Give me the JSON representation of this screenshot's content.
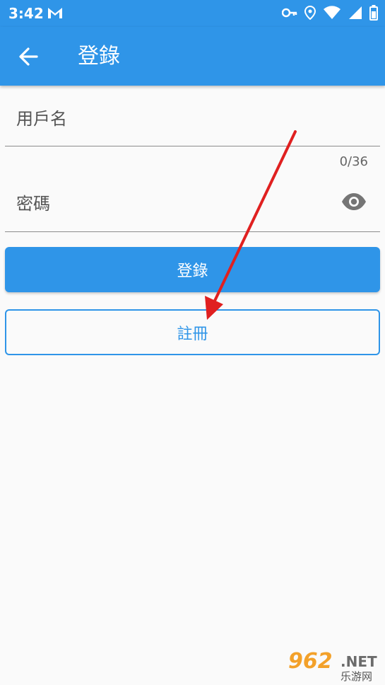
{
  "status_bar": {
    "time": "3:42"
  },
  "app_bar": {
    "title": "登錄"
  },
  "form": {
    "username_label": "用戶名",
    "password_label": "密碼",
    "password_counter": "0/36"
  },
  "buttons": {
    "login": "登錄",
    "register": "註冊"
  },
  "watermark": {
    "number": "962",
    "domain": ".NET",
    "name": "乐游网"
  },
  "colors": {
    "primary": "#2f95e8",
    "annotation_arrow": "#e02020"
  },
  "icons": [
    "gmail-icon",
    "key-icon",
    "location-icon",
    "wifi-icon",
    "signal-icon",
    "battery-icon",
    "back-arrow-icon",
    "eye-icon"
  ]
}
